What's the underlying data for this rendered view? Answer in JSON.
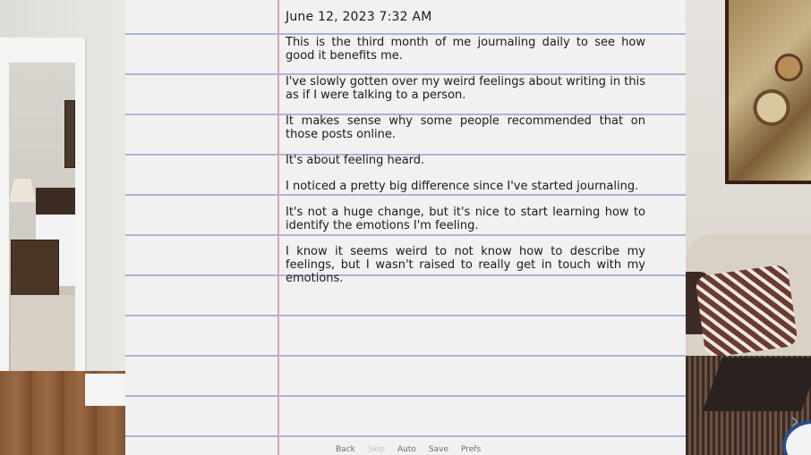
{
  "journal": {
    "date": "June 12, 2023 7:32 AM",
    "paragraphs": [
      "This is the third month of me journaling daily to see how good it benefits me.",
      "I've slowly gotten over my weird feelings about writing in this as if I were talking to a person.",
      "It makes sense why some people recommended that on those posts online.",
      "It's about feeling heard.",
      "I noticed a pretty big difference since I've started journaling.",
      "It's not a huge change, but it's nice to start learning how to identify the emotions I'm feeling.",
      "I know it seems weird to not know how to describe my feelings, but I wasn't raised to really get in touch with my emotions."
    ]
  },
  "quick_menu": {
    "back": "Back",
    "skip": "Skip",
    "auto": "Auto",
    "save": "Save",
    "prefs": "Prefs"
  },
  "navigation": {
    "next_icon": "chevron-right-icon",
    "next_glyph": "›"
  },
  "colors": {
    "paper": "#f1f1f1",
    "rule_line": "#aab3d8",
    "margin_line": "#d9a4a4",
    "ink": "#1a1a1a",
    "menu_text": "#6e6e6e",
    "menu_disabled": "#c4c4c4"
  }
}
